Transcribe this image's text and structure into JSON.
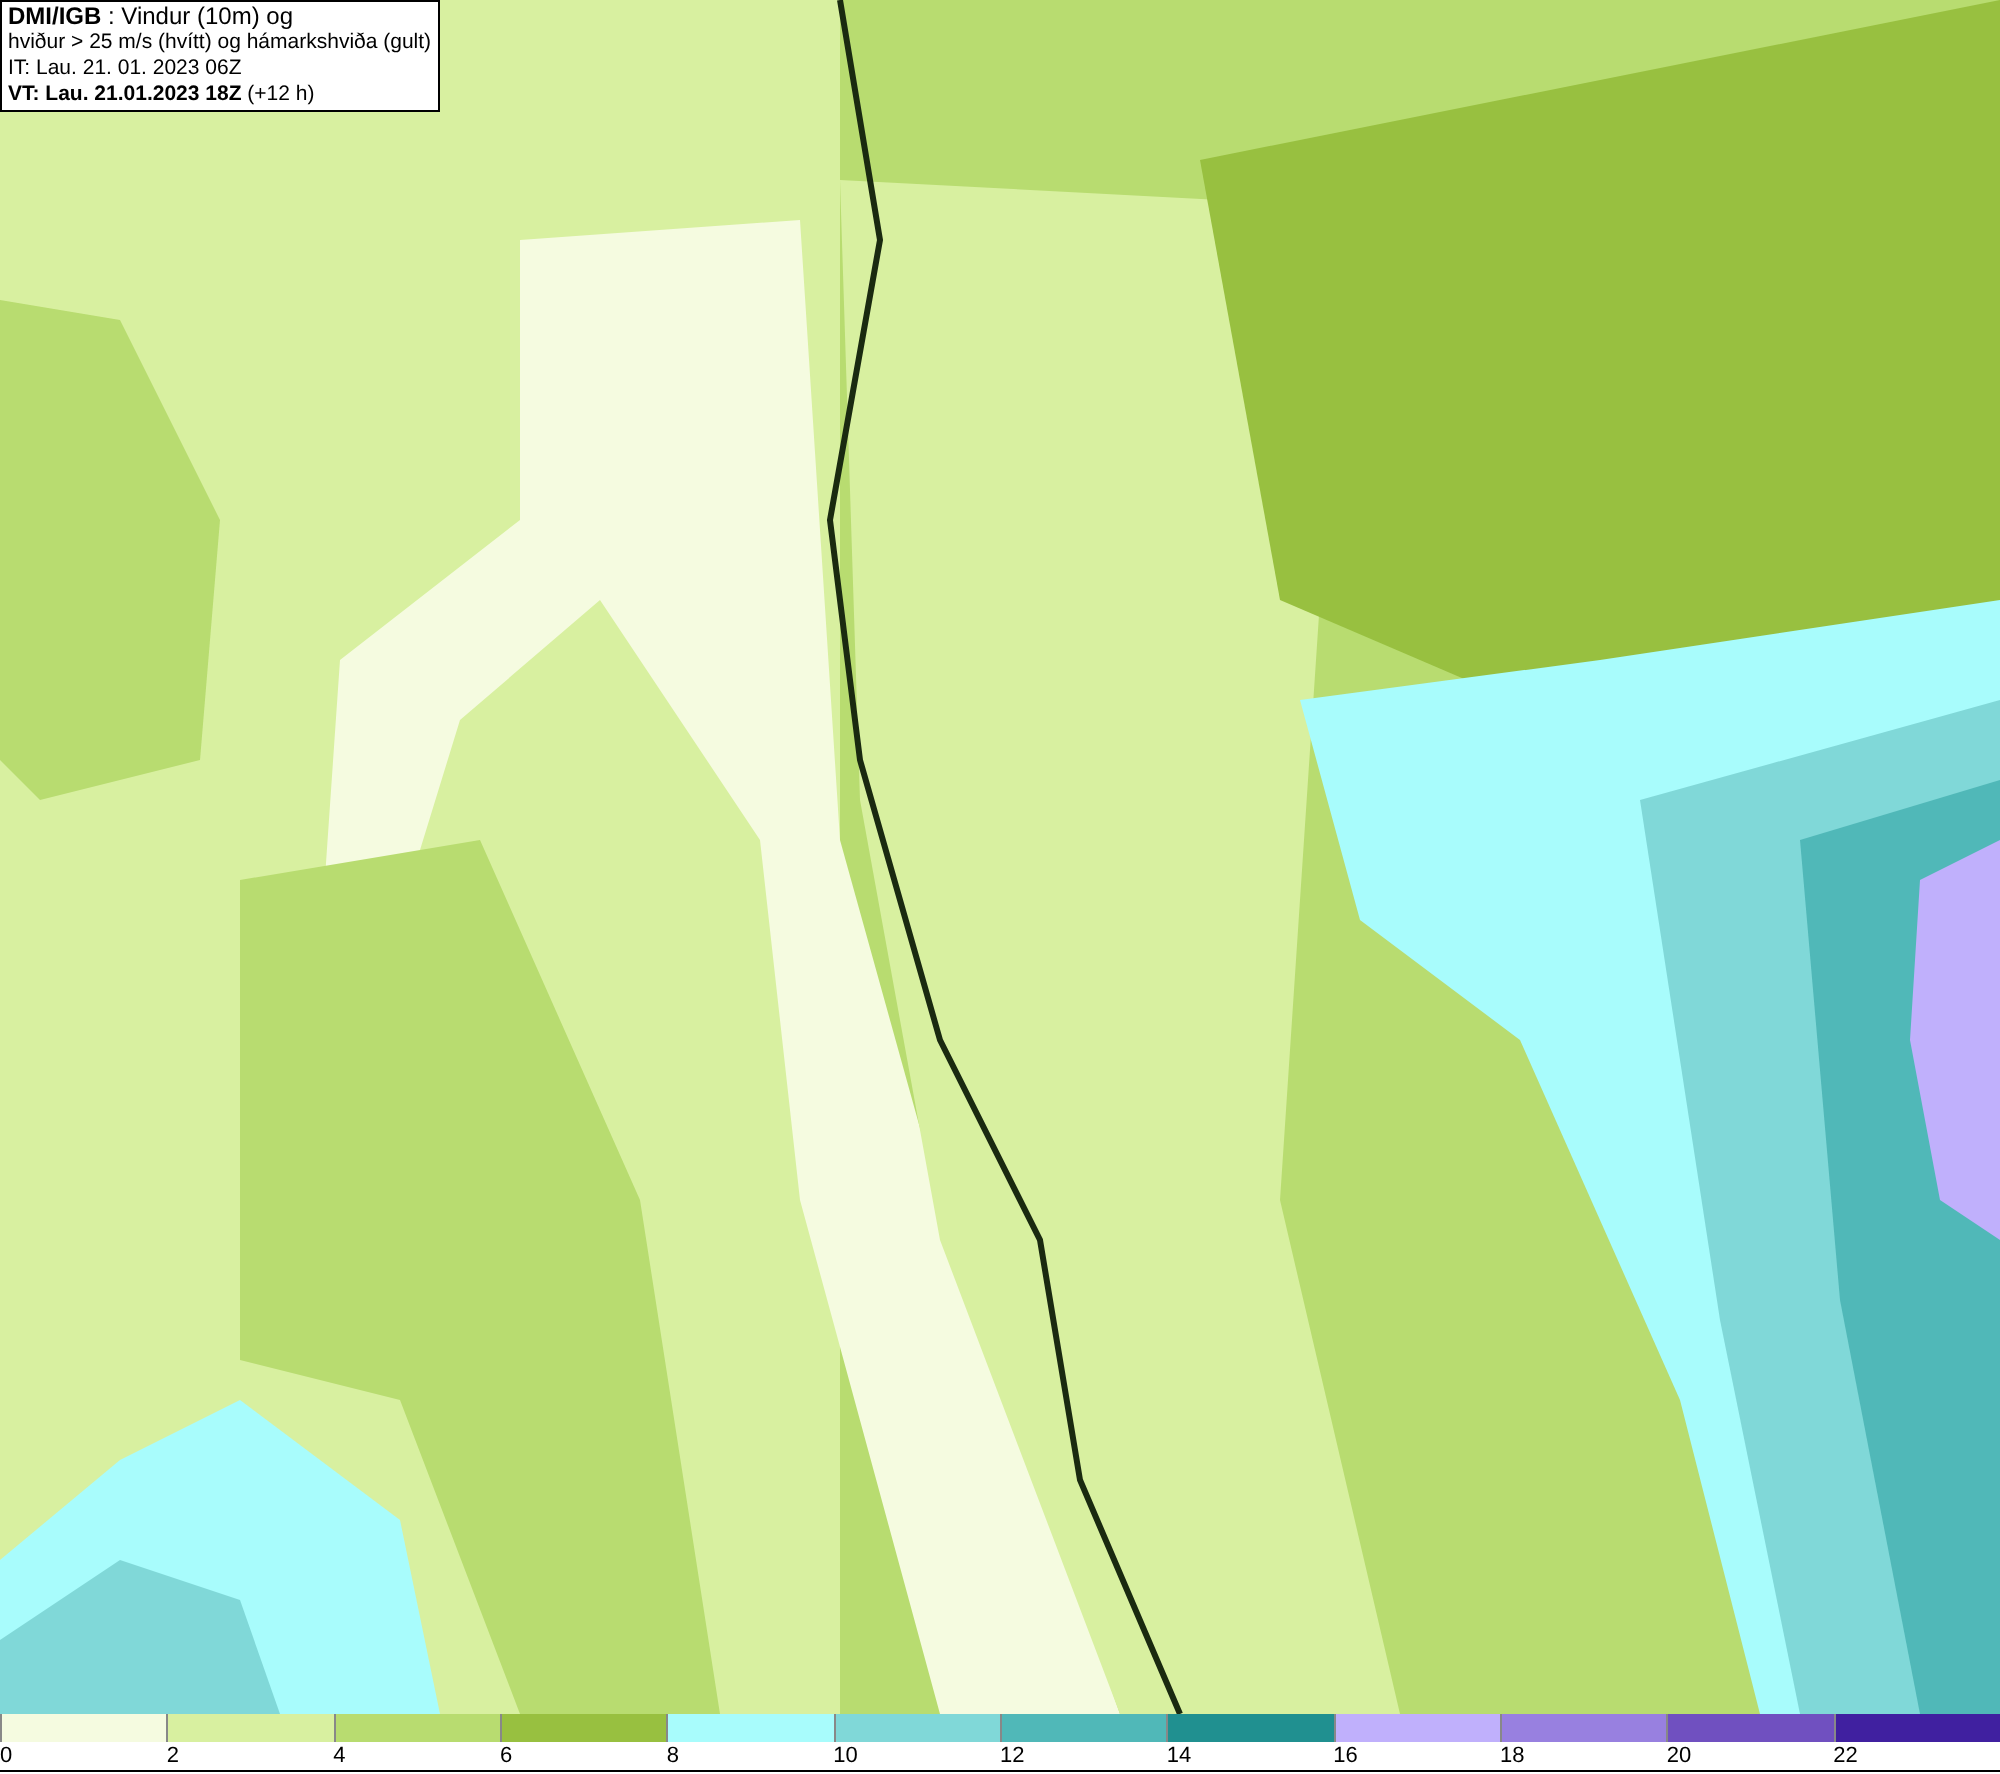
{
  "header": {
    "lines": [
      "**DMI/IGB** : Vindur (10m) og",
      "hviður > 25 m/s (hvítt) og hámarkshviða (gult)",
      "IT: Lau. 21. 01. 2023 06Z",
      "**VT: Lau. 21.01.2023 18Z** (+12 h)"
    ]
  },
  "legend": [
    {
      "label": "0",
      "color": "#f5fbe0"
    },
    {
      "label": "2",
      "color": "#d8f0a0"
    },
    {
      "label": "4",
      "color": "#b8dc70"
    },
    {
      "label": "6",
      "color": "#98c040"
    },
    {
      "label": "8",
      "color": "#a8fcfc"
    },
    {
      "label": "10",
      "color": "#80d8d8"
    },
    {
      "label": "12",
      "color": "#50b8b8"
    },
    {
      "label": "14",
      "color": "#209090"
    },
    {
      "label": "16",
      "color": "#c0b0fc"
    },
    {
      "label": "18",
      "color": "#9880e0"
    },
    {
      "label": "20",
      "color": "#7050c0"
    },
    {
      "label": "22",
      "color": "#4020a0"
    }
  ]
}
